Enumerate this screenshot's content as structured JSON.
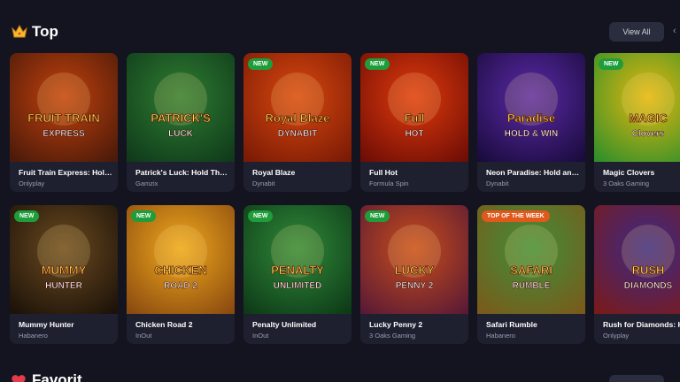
{
  "section": {
    "title": "Top",
    "icon": "crown-icon",
    "view_all": "View All"
  },
  "next_section": {
    "title": "Favorit",
    "icon": "heart-icon"
  },
  "games_row1": [
    {
      "name": "Fruit Train Express: Hol…",
      "provider": "Onlyplay",
      "badge": "",
      "art": "FRUIT TRAIN",
      "art2": "EXPRESS",
      "bg": "#c2410c",
      "bg2": "#4a1a0a"
    },
    {
      "name": "Patrick's Luck: Hold Th…",
      "provider": "Gamzix",
      "badge": "",
      "art": "PATRICK'S",
      "art2": "LUCK",
      "bg": "#2f7d32",
      "bg2": "#0f3a1a"
    },
    {
      "name": "Royal Blaze",
      "provider": "Dynabit",
      "badge": "NEW",
      "art": "Royal Blaze",
      "art2": "DYNABIT",
      "bg": "#d9480f",
      "bg2": "#7a1a05"
    },
    {
      "name": "Full Hot",
      "provider": "Formula Spin",
      "badge": "NEW",
      "art": "Full",
      "art2": "HOT",
      "bg": "#e03a0c",
      "bg2": "#6e0d05"
    },
    {
      "name": "Neon Paradise: Hold an…",
      "provider": "Dynabit",
      "badge": "",
      "art": "Paradise",
      "art2": "HOLD & WIN",
      "bg": "#5b2aa8",
      "bg2": "#1a0b3d"
    },
    {
      "name": "Magic Clovers",
      "provider": "3 Oaks Gaming",
      "badge": "NEW",
      "art": "MAGIC",
      "art2": "Clovers",
      "bg": "#e6b80e",
      "bg2": "#2f8f2a"
    }
  ],
  "games_row2": [
    {
      "name": "Mummy Hunter",
      "provider": "Habanero",
      "badge": "NEW",
      "art": "MUMMY",
      "art2": "HUNTER",
      "bg": "#6b4a1f",
      "bg2": "#1c1209"
    },
    {
      "name": "Chicken Road 2",
      "provider": "InOut",
      "badge": "NEW",
      "art": "CHICKEN",
      "art2": "ROAD 2",
      "bg": "#f0a91c",
      "bg2": "#8a4a10"
    },
    {
      "name": "Penalty Unlimited",
      "provider": "InOut",
      "badge": "NEW",
      "art": "PENALTY",
      "art2": "UNLIMITED",
      "bg": "#2f8a3a",
      "bg2": "#0e3a17"
    },
    {
      "name": "Lucky Penny 2",
      "provider": "3 Oaks Gaming",
      "badge": "NEW",
      "art": "LUCKY",
      "art2": "PENNY 2",
      "bg": "#c94d1b",
      "bg2": "#5a1a35"
    },
    {
      "name": "Safari Rumble",
      "provider": "Habanero",
      "badge": "TOP OF THE WEEK",
      "art": "SAFARI",
      "art2": "RUMBLE",
      "bg": "#3f8f3a",
      "bg2": "#7a5a1a"
    },
    {
      "name": "Rush for Diamonds: H…",
      "provider": "Onlyplay",
      "badge": "",
      "art": "RUSH",
      "art2": "DIAMONDS",
      "bg": "#3a2a88",
      "bg2": "#7a1a1a"
    }
  ],
  "colors": {
    "background": "#13141f",
    "card": "#1e2030",
    "badge_new": "#1f9d3a",
    "badge_top": "#e0591c"
  }
}
